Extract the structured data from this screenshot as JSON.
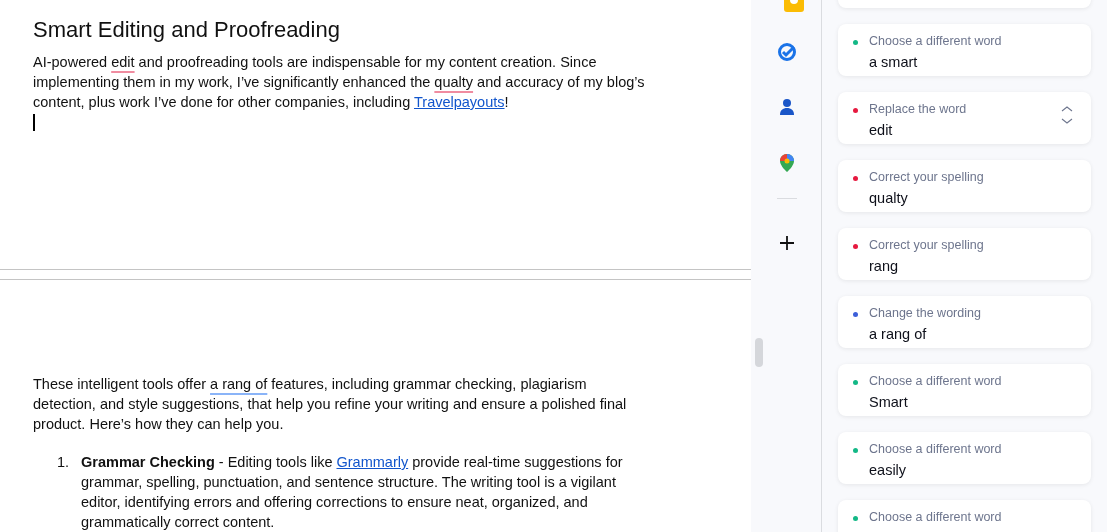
{
  "document": {
    "pages": [
      {
        "heading": "Smart Editing and Proofreading",
        "paragraphs": [
          [
            {
              "kind": "plain",
              "text": "AI-powered "
            },
            {
              "kind": "error",
              "text": "edit"
            },
            {
              "kind": "plain",
              "text": " and proofreading tools are indispensable for my content creation. Since implementing them in my work, I’ve significantly enhanced the "
            },
            {
              "kind": "error",
              "text": "qualty"
            },
            {
              "kind": "plain",
              "text": " and accuracy of my blog’s content, plus work I’ve done for other companies, including "
            },
            {
              "kind": "link",
              "text": "Travelpayouts"
            },
            {
              "kind": "plain",
              "text": "!"
            }
          ]
        ],
        "cursor": true
      },
      {
        "paragraphs": [
          [
            {
              "kind": "plain",
              "text": "These intelligent tools offer "
            },
            {
              "kind": "style",
              "text": "a rang of"
            },
            {
              "kind": "plain",
              "text": " features, including grammar checking, plagiarism detection, and style suggestions, that help you refine your writing and ensure a polished final product. Here’s how they can help you."
            }
          ]
        ],
        "list": [
          {
            "number": "1.",
            "segments": [
              {
                "kind": "bold",
                "text": "Grammar Checking"
              },
              {
                "kind": "plain",
                "text": " - Editing tools like "
              },
              {
                "kind": "link",
                "text": "Grammarly"
              },
              {
                "kind": "plain",
                "text": " provide real-time suggestions for grammar, spelling, punctuation, and sentence structure. The writing tool is a vigilant editor, identifying errors and offering corrections to ensure neat, organized, and grammatically correct content."
              }
            ]
          }
        ]
      }
    ]
  },
  "suggestions": [
    {
      "label": "Choose a different word",
      "value": "a smart",
      "color": "#13b886",
      "arrows": false
    },
    {
      "label": "Replace the word",
      "value": "edit",
      "color": "#e6193f",
      "arrows": true
    },
    {
      "label": "Correct your spelling",
      "value": "qualty",
      "color": "#e6193f",
      "arrows": false
    },
    {
      "label": "Correct your spelling",
      "value": "rang",
      "color": "#e6193f",
      "arrows": false
    },
    {
      "label": "Change the wording",
      "value": "a rang of",
      "color": "#3d5fd9",
      "arrows": false
    },
    {
      "label": "Choose a different word",
      "value": "Smart",
      "color": "#13b886",
      "arrows": false
    },
    {
      "label": "Choose a different word",
      "value": "easily",
      "color": "#13b886",
      "arrows": false
    },
    {
      "label": "Choose a different word",
      "color": "#13b886",
      "arrows": false
    }
  ]
}
